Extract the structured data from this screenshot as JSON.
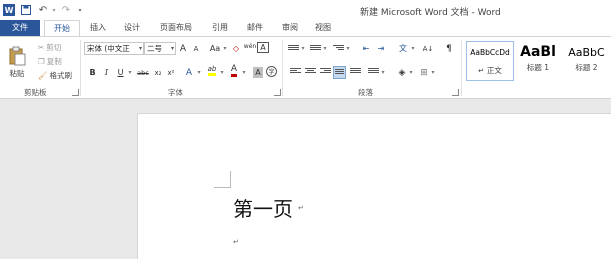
{
  "title_bar": {
    "title": "新建 Microsoft Word 文档 - Word",
    "app_icon": "word-icon",
    "quick_access": [
      "save-icon",
      "undo-icon",
      "redo-icon",
      "customize-icon"
    ]
  },
  "tabs": [
    {
      "label": "文件",
      "active": false
    },
    {
      "label": "开始",
      "active": true
    },
    {
      "label": "插入",
      "active": false
    },
    {
      "label": "设计",
      "active": false
    },
    {
      "label": "页面布局",
      "active": false
    },
    {
      "label": "引用",
      "active": false
    },
    {
      "label": "邮件",
      "active": false
    },
    {
      "label": "审阅",
      "active": false
    },
    {
      "label": "视图",
      "active": false
    }
  ],
  "clipboard": {
    "paste": "粘贴",
    "cut": "剪切",
    "copy": "复制",
    "format_painter": "格式刷",
    "group_label": "剪贴板"
  },
  "font": {
    "name": "宋体 (中文正",
    "size": "二号",
    "grow": "A",
    "shrink": "A",
    "case": "Aa",
    "phonetic": "wén",
    "enclose": "A",
    "bold": "B",
    "italic": "I",
    "underline": "U",
    "strike": "abc",
    "subscript": "x₂",
    "superscript": "x²",
    "text_effect": "A",
    "highlight": "ab",
    "font_color": "A",
    "char_shading": "A",
    "char_enclose": "字",
    "group_label": "字体"
  },
  "paragraph": {
    "group_label": "段落",
    "sort": "A↓",
    "show_marks": "¶"
  },
  "styles": [
    {
      "sample": "AaBbCcDd",
      "name": "↵ 正文"
    },
    {
      "sample": "AaBl",
      "name": "标题 1"
    },
    {
      "sample": "AaBbC",
      "name": "标题 2"
    }
  ],
  "document": {
    "heading": "第一页",
    "para_mark": "↵"
  },
  "colors": {
    "accent": "#2b579a",
    "highlight": "#ffff00",
    "font_color": "#c00000"
  }
}
